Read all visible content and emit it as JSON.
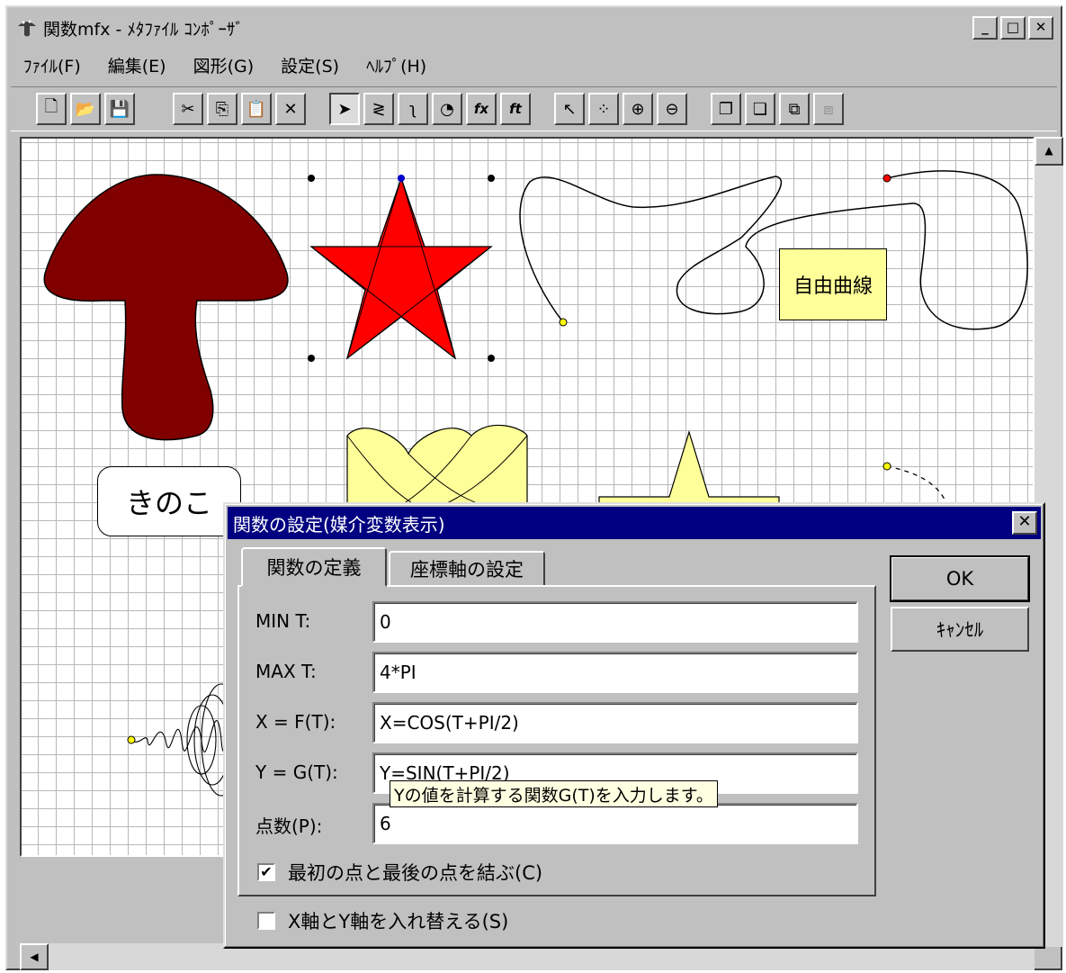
{
  "window": {
    "title": "関数mfx - ﾒﾀﾌｧｲﾙ ｺﾝﾎﾟｰｻﾞ",
    "minimize": "_",
    "maximize": "□",
    "close": "✕"
  },
  "menu": [
    "ﾌｧｲﾙ(F)",
    "編集(E)",
    "図形(G)",
    "設定(S)",
    "ﾍﾙﾌﾟ(H)"
  ],
  "toolbar": [
    {
      "name": "new-icon",
      "glyph": "🗋"
    },
    {
      "name": "open-icon",
      "glyph": "📂"
    },
    {
      "name": "save-icon",
      "glyph": "💾"
    },
    {
      "name": "cut-icon",
      "glyph": "✂"
    },
    {
      "name": "copy-icon",
      "glyph": "⎘"
    },
    {
      "name": "paste-icon",
      "glyph": "📋"
    },
    {
      "name": "delete-icon",
      "glyph": "✕"
    },
    {
      "name": "select-arrow-icon",
      "glyph": "➤"
    },
    {
      "name": "polyline-icon",
      "glyph": "≷"
    },
    {
      "name": "curve-icon",
      "glyph": "ʅ"
    },
    {
      "name": "shape-icon",
      "glyph": "◔"
    },
    {
      "name": "function-fx-icon",
      "glyph": "fx"
    },
    {
      "name": "function-ft-icon",
      "glyph": "ft"
    },
    {
      "name": "move-point-icon",
      "glyph": "↖"
    },
    {
      "name": "select-points-icon",
      "glyph": "⁘"
    },
    {
      "name": "add-point-icon",
      "glyph": "⊕"
    },
    {
      "name": "remove-point-icon",
      "glyph": "⊖"
    },
    {
      "name": "bring-front-icon",
      "glyph": "❐"
    },
    {
      "name": "send-back-icon",
      "glyph": "❏"
    },
    {
      "name": "group-icon",
      "glyph": "⧉"
    },
    {
      "name": "ungroup-icon",
      "glyph": "⧈"
    }
  ],
  "canvas": {
    "kinoko_label": "きのこ",
    "free_curve_label": "自由曲線",
    "colors": {
      "mushroom": "#800000",
      "star": "#ff0000",
      "pale_fill": "#ffff99"
    }
  },
  "dialog": {
    "title": "関数の設定(媒介変数表示)",
    "close": "✕",
    "tabs": [
      "関数の定義",
      "座標軸の設定"
    ],
    "fields": [
      {
        "label": "MIN T:",
        "value": "0"
      },
      {
        "label": "MAX T:",
        "value": "4*PI"
      },
      {
        "label": "X = F(T):",
        "value": "X=COS(T+PI/2)"
      },
      {
        "label": "Y = G(T):",
        "value": "Y=SIN(T+PI/2)"
      },
      {
        "label": "点数(P):",
        "value": "6"
      }
    ],
    "checkbox_connect": {
      "label": "最初の点と最後の点を結ぶ(C)",
      "checked": true
    },
    "checkbox_swap": {
      "label": "X軸とY軸を入れ替える(S)",
      "checked": false
    },
    "ok": "OK",
    "cancel": "ｷｬﾝｾﾙ",
    "tooltip": "Yの値を計算する関数G(T)を入力します。"
  }
}
